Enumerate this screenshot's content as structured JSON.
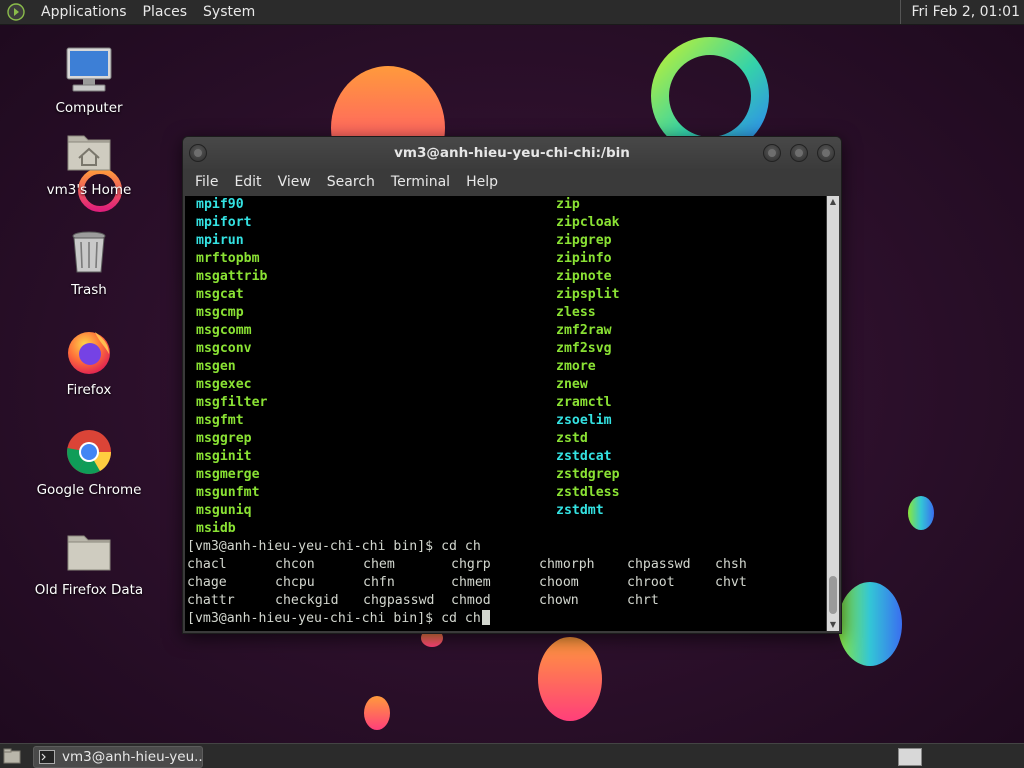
{
  "top_panel": {
    "menus": [
      "Applications",
      "Places",
      "System"
    ],
    "clock": "Fri Feb  2, 01:01"
  },
  "desktop_icons": [
    {
      "label": "Computer",
      "icon": "computer-icon"
    },
    {
      "label": "vm3's Home",
      "icon": "home-folder-icon"
    },
    {
      "label": "Trash",
      "icon": "trash-icon"
    },
    {
      "label": "Firefox",
      "icon": "firefox-icon"
    },
    {
      "label": "Google Chrome",
      "icon": "chrome-icon"
    },
    {
      "label": "Old Firefox Data",
      "icon": "folder-icon"
    }
  ],
  "terminal": {
    "title": "vm3@anh-hieu-yeu-chi-chi:/bin",
    "menu": [
      "File",
      "Edit",
      "View",
      "Search",
      "Terminal",
      "Help"
    ],
    "listing": [
      {
        "left": "mpif90",
        "lc": "cyan",
        "right": "zip",
        "rc": "green"
      },
      {
        "left": "mpifort",
        "lc": "cyan",
        "right": "zipcloak",
        "rc": "green"
      },
      {
        "left": "mpirun",
        "lc": "cyan",
        "right": "zipgrep",
        "rc": "green"
      },
      {
        "left": "mrftopbm",
        "lc": "green",
        "right": "zipinfo",
        "rc": "green"
      },
      {
        "left": "msgattrib",
        "lc": "green",
        "right": "zipnote",
        "rc": "green"
      },
      {
        "left": "msgcat",
        "lc": "green",
        "right": "zipsplit",
        "rc": "green"
      },
      {
        "left": "msgcmp",
        "lc": "green",
        "right": "zless",
        "rc": "green"
      },
      {
        "left": "msgcomm",
        "lc": "green",
        "right": "zmf2raw",
        "rc": "green"
      },
      {
        "left": "msgconv",
        "lc": "green",
        "right": "zmf2svg",
        "rc": "green"
      },
      {
        "left": "msgen",
        "lc": "green",
        "right": "zmore",
        "rc": "green"
      },
      {
        "left": "msgexec",
        "lc": "green",
        "right": "znew",
        "rc": "green"
      },
      {
        "left": "msgfilter",
        "lc": "green",
        "right": "zramctl",
        "rc": "green"
      },
      {
        "left": "msgfmt",
        "lc": "green",
        "right": "zsoelim",
        "rc": "cyan"
      },
      {
        "left": "msggrep",
        "lc": "green",
        "right": "zstd",
        "rc": "green"
      },
      {
        "left": "msginit",
        "lc": "green",
        "right": "zstdcat",
        "rc": "cyan"
      },
      {
        "left": "msgmerge",
        "lc": "green",
        "right": "zstdgrep",
        "rc": "green"
      },
      {
        "left": "msgunfmt",
        "lc": "green",
        "right": "zstdless",
        "rc": "green"
      },
      {
        "left": "msguniq",
        "lc": "green",
        "right": "zstdmt",
        "rc": "cyan"
      },
      {
        "left": "msidb",
        "lc": "green",
        "right": "",
        "rc": "green"
      }
    ],
    "prompt1": "[vm3@anh-hieu-yeu-chi-chi bin]$ cd ch",
    "completions": [
      [
        "chacl",
        "chcon",
        "chem",
        "chgrp",
        "chmorph",
        "chpasswd",
        "chsh"
      ],
      [
        "chage",
        "chcpu",
        "chfn",
        "chmem",
        "choom",
        "chroot",
        "chvt"
      ],
      [
        "chattr",
        "checkgid",
        "chgpasswd",
        "chmod",
        "chown",
        "chrt",
        ""
      ]
    ],
    "prompt2": "[vm3@anh-hieu-yeu-chi-chi bin]$ cd ch"
  },
  "bottom_panel": {
    "task_label": "vm3@anh-hieu-yeu..."
  },
  "colors": {
    "background": "#2a0f2a",
    "term_green": "#8ae234",
    "term_cyan": "#34e2e2",
    "term_text": "#d3d7cf"
  }
}
